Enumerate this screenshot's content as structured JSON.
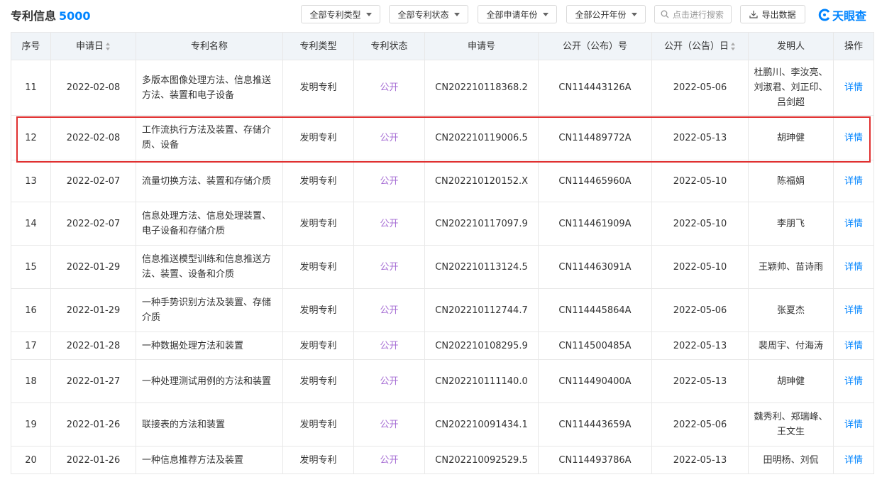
{
  "header": {
    "title": "专利信息",
    "count": "5000",
    "filters": [
      {
        "label": "全部专利类型"
      },
      {
        "label": "全部专利状态"
      },
      {
        "label": "全部申请年份"
      },
      {
        "label": "全部公开年份"
      }
    ],
    "search_placeholder": "点击进行搜索",
    "export_label": "导出数据",
    "logo_text": "天眼查"
  },
  "table": {
    "columns": [
      "序号",
      "申请日",
      "专利名称",
      "专利类型",
      "专利状态",
      "申请号",
      "公开（公布）号",
      "公开（公告）日",
      "发明人",
      "操作"
    ],
    "rows": [
      {
        "no": "11",
        "date": "2022-02-08",
        "name": "多版本图像处理方法、信息推送方法、装置和电子设备",
        "type": "发明专利",
        "status": "公开",
        "app_no": "CN202210118368.2",
        "pub_no": "CN114443126A",
        "pub_date": "2022-05-06",
        "inventor": "杜鹏川、李汝亮、刘淑君、刘正印、吕剑超",
        "op": "详情"
      },
      {
        "no": "12",
        "date": "2022-02-08",
        "name": "工作流执行方法及装置、存储介质、设备",
        "type": "发明专利",
        "status": "公开",
        "app_no": "CN202210119006.5",
        "pub_no": "CN114489772A",
        "pub_date": "2022-05-13",
        "inventor": "胡珅健",
        "op": "详情"
      },
      {
        "no": "13",
        "date": "2022-02-07",
        "name": "流量切换方法、装置和存储介质",
        "type": "发明专利",
        "status": "公开",
        "app_no": "CN202210120152.X",
        "pub_no": "CN114465960A",
        "pub_date": "2022-05-10",
        "inventor": "陈福娟",
        "op": "详情"
      },
      {
        "no": "14",
        "date": "2022-02-07",
        "name": "信息处理方法、信息处理装置、电子设备和存储介质",
        "type": "发明专利",
        "status": "公开",
        "app_no": "CN202210117097.9",
        "pub_no": "CN114461909A",
        "pub_date": "2022-05-10",
        "inventor": "李朋飞",
        "op": "详情"
      },
      {
        "no": "15",
        "date": "2022-01-29",
        "name": "信息推送模型训练和信息推送方法、装置、设备和介质",
        "type": "发明专利",
        "status": "公开",
        "app_no": "CN202210113124.5",
        "pub_no": "CN114463091A",
        "pub_date": "2022-05-10",
        "inventor": "王颖帅、苗诗雨",
        "op": "详情"
      },
      {
        "no": "16",
        "date": "2022-01-29",
        "name": "一种手势识别方法及装置、存储介质",
        "type": "发明专利",
        "status": "公开",
        "app_no": "CN202210112744.7",
        "pub_no": "CN114445864A",
        "pub_date": "2022-05-06",
        "inventor": "张夏杰",
        "op": "详情"
      },
      {
        "no": "17",
        "date": "2022-01-28",
        "name": "一种数据处理方法和装置",
        "type": "发明专利",
        "status": "公开",
        "app_no": "CN202210108295.9",
        "pub_no": "CN114500485A",
        "pub_date": "2022-05-13",
        "inventor": "裴周宇、付海涛",
        "op": "详情"
      },
      {
        "no": "18",
        "date": "2022-01-27",
        "name": "一种处理测试用例的方法和装置",
        "type": "发明专利",
        "status": "公开",
        "app_no": "CN202210111140.0",
        "pub_no": "CN114490400A",
        "pub_date": "2022-05-13",
        "inventor": "胡珅健",
        "op": "详情"
      },
      {
        "no": "19",
        "date": "2022-01-26",
        "name": "联接表的方法和装置",
        "type": "发明专利",
        "status": "公开",
        "app_no": "CN202210091434.1",
        "pub_no": "CN114443659A",
        "pub_date": "2022-05-06",
        "inventor": "魏秀利、郑瑞峰、王文生",
        "op": "详情"
      },
      {
        "no": "20",
        "date": "2022-01-26",
        "name": "一种信息推荐方法及装置",
        "type": "发明专利",
        "status": "公开",
        "app_no": "CN202210092529.5",
        "pub_no": "CN114493786A",
        "pub_date": "2022-05-13",
        "inventor": "田明杨、刘侃",
        "op": "详情"
      }
    ]
  },
  "highlighted_row": "12",
  "colors": {
    "accent": "#0084ff",
    "status_text": "#a66dd4",
    "header_bg": "#f0f4f8",
    "highlight_border": "#e03030"
  }
}
